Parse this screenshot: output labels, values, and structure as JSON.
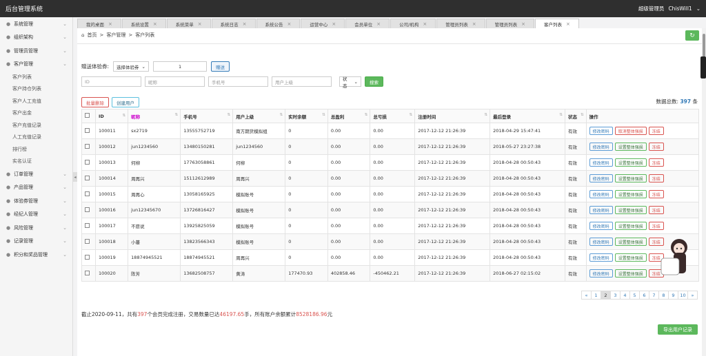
{
  "topbar": {
    "title": "后台管理系统",
    "role": "超级管理员",
    "username": "ChisWill1"
  },
  "sidebar": {
    "items": [
      {
        "label": "系统管理",
        "icon": "gear-icon"
      },
      {
        "label": "组织架构",
        "icon": "org-icon"
      },
      {
        "label": "管理员管理",
        "icon": "user-icon"
      },
      {
        "label": "客户管理",
        "icon": "users-icon"
      }
    ],
    "sub_items": [
      "客户列表",
      "客户持仓列表",
      "客户人工充值",
      "客户出金",
      "客户充值记录",
      "人工充值记录",
      "排行榜",
      "实名认证"
    ],
    "items_after": [
      {
        "label": "订单管理",
        "icon": "list-icon"
      },
      {
        "label": "产品管理",
        "icon": "cart-icon"
      },
      {
        "label": "体验券管理",
        "icon": "ticket-icon"
      },
      {
        "label": "经纪人管理",
        "icon": "broker-icon"
      },
      {
        "label": "风险管理",
        "icon": "shield-icon"
      },
      {
        "label": "记录管理",
        "icon": "doc-icon"
      },
      {
        "label": "积分和奖品管理",
        "icon": "gift-icon"
      }
    ]
  },
  "tabs": [
    "我的桌面",
    "系统设置",
    "系统菜单",
    "系统日志",
    "系统公告",
    "运营中心",
    "会员单位",
    "公司/机构",
    "管理员列表",
    "管理员列表",
    "客户列表"
  ],
  "breadcrumb": {
    "home": "首页",
    "level1": "客户管理",
    "level2": "客户列表"
  },
  "form": {
    "gift_label": "赠送体验券:",
    "voucher_select": "选择体验券",
    "quantity": "1",
    "gift_button": "赠送",
    "id_placeholder": "ID",
    "nickname_placeholder": "昵称",
    "phone_placeholder": "手机号",
    "upline_placeholder": "用户上级",
    "status_select": "状态",
    "search_button": "搜索",
    "batch_delete": "批量删除",
    "create_user": "创建用户"
  },
  "total": {
    "label": "数据总数:",
    "count": "397",
    "unit": "条"
  },
  "table": {
    "headers": [
      "ID",
      "昵称",
      "手机号",
      "用户上级",
      "实时余额",
      "总盈利",
      "总亏损",
      "注册时间",
      "最后登录",
      "状态",
      "操作"
    ],
    "rows": [
      {
        "id": "100011",
        "nick": "sx2719",
        "phone": "13555752719",
        "upline": "南方期货模拟组",
        "bal": "0",
        "profit": "0.00",
        "loss": "0.00",
        "reg": "2017-12-12 21:26:39",
        "last": "2018-04-29 15:47:41",
        "status": "有效",
        "op1": "修改密码",
        "op2": "取消整体强损",
        "op3": "冻结",
        "op2red": true
      },
      {
        "id": "100012",
        "nick": "jun1234560",
        "phone": "13480150281",
        "upline": "jun1234560",
        "bal": "0",
        "profit": "0.00",
        "loss": "0.00",
        "reg": "2017-12-12 21:26:39",
        "last": "2018-05-27 23:27:38",
        "status": "有效",
        "op1": "修改密码",
        "op2": "设置整体强损",
        "op3": "冻结"
      },
      {
        "id": "100013",
        "nick": "何柳",
        "phone": "17763058861",
        "upline": "何柳",
        "bal": "0",
        "profit": "0.00",
        "loss": "0.00",
        "reg": "2017-12-12 21:26:39",
        "last": "2018-04-28 00:50:43",
        "status": "有效",
        "op1": "修改密码",
        "op2": "设置整体强损",
        "op3": "冻结"
      },
      {
        "id": "100014",
        "nick": "周再兴",
        "phone": "15112612989",
        "upline": "周再兴",
        "bal": "0",
        "profit": "0.00",
        "loss": "0.00",
        "reg": "2017-12-12 21:26:39",
        "last": "2018-04-28 00:50:43",
        "status": "有效",
        "op1": "修改密码",
        "op2": "设置整体强损",
        "op3": "冻结"
      },
      {
        "id": "100015",
        "nick": "周再心",
        "phone": "13058165925",
        "upline": "模拟账号",
        "bal": "0",
        "profit": "0.00",
        "loss": "0.00",
        "reg": "2017-12-12 21:26:39",
        "last": "2018-04-28 00:50:43",
        "status": "有效",
        "op1": "修改密码",
        "op2": "设置整体强损",
        "op3": "冻结"
      },
      {
        "id": "100016",
        "nick": "jun12345670",
        "phone": "13726816427",
        "upline": "模拟账号",
        "bal": "0",
        "profit": "0.00",
        "loss": "0.00",
        "reg": "2017-12-12 21:26:39",
        "last": "2018-04-28 00:50:43",
        "status": "有效",
        "op1": "修改密码",
        "op2": "设置整体强损",
        "op3": "冻结"
      },
      {
        "id": "100017",
        "nick": "不愿说",
        "phone": "13925825059",
        "upline": "模拟账号",
        "bal": "0",
        "profit": "0.00",
        "loss": "0.00",
        "reg": "2017-12-12 21:26:39",
        "last": "2018-04-28 00:50:43",
        "status": "有效",
        "op1": "修改密码",
        "op2": "设置整体强损",
        "op3": "冻结"
      },
      {
        "id": "100018",
        "nick": "小蔓",
        "phone": "13823566343",
        "upline": "模拟账号",
        "bal": "0",
        "profit": "0.00",
        "loss": "0.00",
        "reg": "2017-12-12 21:26:39",
        "last": "2018-04-28 00:50:43",
        "status": "有效",
        "op1": "修改密码",
        "op2": "设置整体强损",
        "op3": "冻结"
      },
      {
        "id": "100019",
        "nick": "18874945521",
        "phone": "18874945521",
        "upline": "周再兴",
        "bal": "0",
        "profit": "0.00",
        "loss": "0.00",
        "reg": "2017-12-12 21:26:39",
        "last": "2018-04-28 00:50:43",
        "status": "有效",
        "op1": "修改密码",
        "op2": "设置整体强损",
        "op3": "冻结"
      },
      {
        "id": "100020",
        "nick": "陈芳",
        "phone": "13682508757",
        "upline": "黄涛",
        "bal": "177470.93",
        "profit": "402858.46",
        "loss": "-450462.21",
        "reg": "2017-12-12 21:26:39",
        "last": "2018-06-27 02:15:02",
        "status": "有效",
        "op1": "修改密码",
        "op2": "设置整体强损",
        "op3": "冻结"
      }
    ]
  },
  "pagination": {
    "prev": "«",
    "pages": [
      "1",
      "2",
      "3",
      "4",
      "5",
      "6",
      "7",
      "8",
      "9",
      "10"
    ],
    "current": "2",
    "next": "»"
  },
  "summary": {
    "p1": "截止2020-09-11，共有",
    "n1": "397",
    "p2": "个会员完成注册，交易数量已达",
    "n2": "46197.65",
    "p3": "手，所有账户余额累计",
    "n3": "8528186.96",
    "p4": "元"
  },
  "export_button": "导出用户记录"
}
